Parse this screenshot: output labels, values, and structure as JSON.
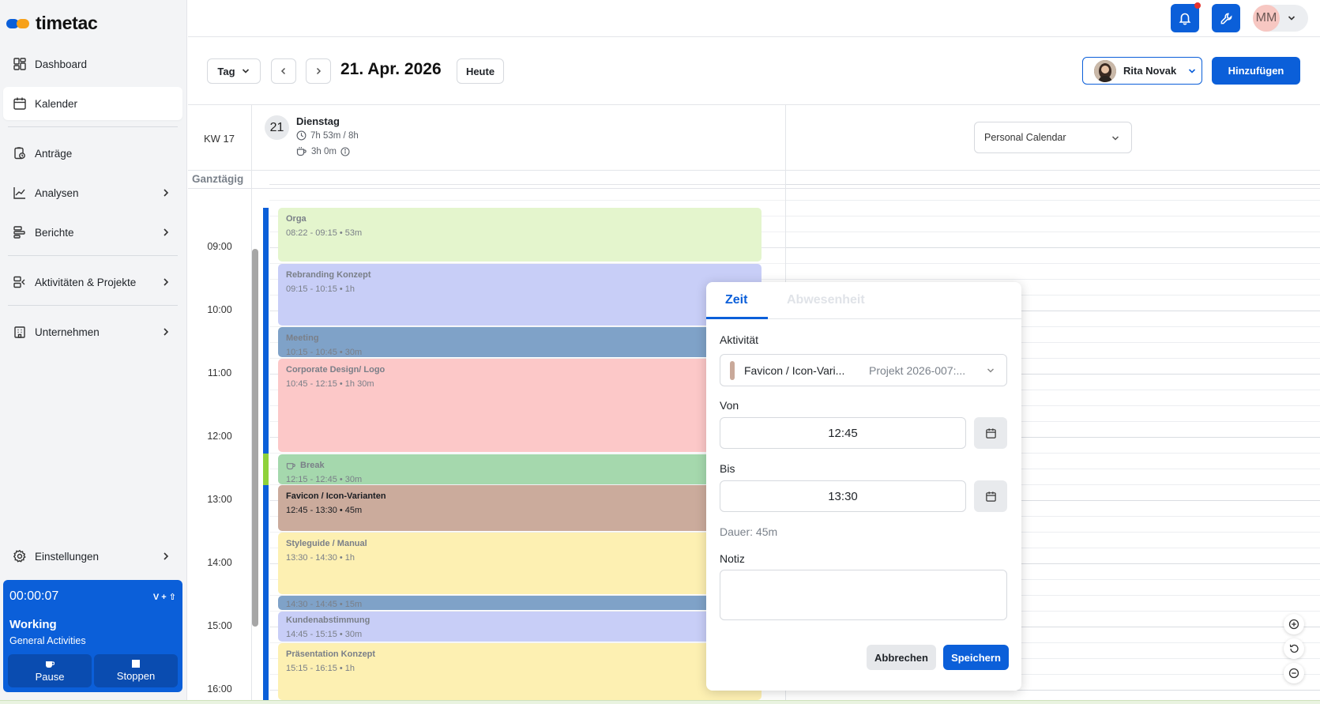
{
  "app": {
    "brand": "timetac"
  },
  "sidebar": {
    "items": [
      {
        "label": "Dashboard",
        "icon": "dashboard-icon"
      },
      {
        "label": "Kalender",
        "icon": "calendar-icon",
        "active": true
      },
      {
        "label": "Anträge",
        "icon": "requests-icon"
      },
      {
        "label": "Analysen",
        "icon": "analytics-icon"
      },
      {
        "label": "Berichte",
        "icon": "reports-icon"
      },
      {
        "label": "Aktivitäten & Projekte",
        "icon": "projects-icon"
      },
      {
        "label": "Unternehmen",
        "icon": "company-icon"
      },
      {
        "label": "Einstellungen",
        "icon": "gear-icon"
      }
    ]
  },
  "timer": {
    "elapsed": "00:00:07",
    "shortcut": "V + ⇧",
    "status": "Working",
    "activity": "General Activities",
    "pause_label": "Pause",
    "stop_label": "Stoppen"
  },
  "topbar": {
    "user_initials": "MM"
  },
  "toolbar": {
    "view_label": "Tag",
    "date_title": "21. Apr. 2026",
    "today_label": "Heute",
    "person_name": "Rita Novak",
    "add_label": "Hinzufügen"
  },
  "calendar": {
    "week_label": "KW 17",
    "day_number": "21",
    "day_name": "Dienstag",
    "worked": "7h 53m / 8h",
    "breaks": "3h 0m",
    "calendar_select": "Personal Calendar",
    "allday_label": "Ganztägig",
    "hours": [
      "09:00",
      "10:00",
      "11:00",
      "12:00",
      "13:00",
      "14:00",
      "15:00",
      "16:00"
    ],
    "events": [
      {
        "title": "Orga",
        "time": "08:22 - 09:15 • 53m",
        "color": "#e4f5cd"
      },
      {
        "title": "Rebranding Konzept",
        "time": "09:15 - 10:15 • 1h",
        "color": "#c8cef7"
      },
      {
        "title": "Meeting",
        "time": "10:15 - 10:45 • 30m",
        "color": "#7fa2c8"
      },
      {
        "title": "Corporate Design/ Logo",
        "time": "10:45 - 12:15 • 1h 30m",
        "color": "#fcc8c8"
      },
      {
        "title": "Break",
        "time": "12:15 - 12:45 • 30m",
        "color": "#a5d8ad"
      },
      {
        "title": "Favicon / Icon-Varianten",
        "time": "12:45 - 13:30 • 45m",
        "color": "#cbab9c"
      },
      {
        "title": "Styleguide / Manual",
        "time": "13:30 - 14:30 • 1h",
        "color": "#fdf0b2"
      },
      {
        "title": "",
        "time": "14:30 - 14:45 • 15m",
        "color": "#7fa2c8"
      },
      {
        "title": "Kundenabstimmung",
        "time": "14:45 - 15:15 • 30m",
        "color": "#c8cef7"
      },
      {
        "title": "Präsentation Konzept",
        "time": "15:15 - 16:15 • 1h",
        "color": "#fdf0b2"
      }
    ]
  },
  "popup": {
    "tab_time": "Zeit",
    "tab_absence": "Abwesenheit",
    "activity_label": "Aktivität",
    "activity_value": "Favicon / Icon-Vari...",
    "activity_project": "Projekt 2026-007:...",
    "from_label": "Von",
    "from_value": "12:45",
    "to_label": "Bis",
    "to_value": "13:30",
    "duration": "Dauer: 45m",
    "note_label": "Notiz",
    "note_value": "",
    "cancel_label": "Abbrechen",
    "save_label": "Speichern"
  },
  "colors": {
    "accent": "#0b5fd9",
    "notification": "#e5322d"
  }
}
